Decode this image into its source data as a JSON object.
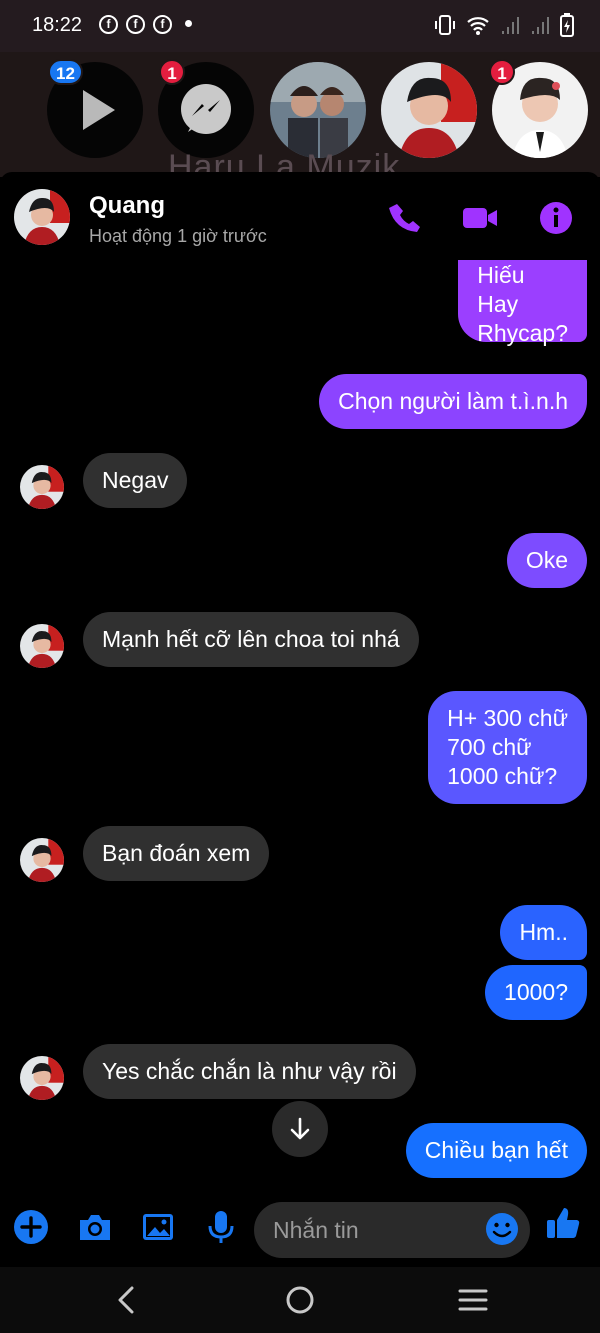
{
  "status_bar": {
    "time": "18:22",
    "notification_icon_glyph": "f",
    "icons": [
      "facebook-notification-icon",
      "facebook-notification-icon",
      "facebook-notification-icon",
      "vibrate-icon",
      "wifi-icon",
      "signal-icon",
      "signal-icon",
      "battery-charging-icon"
    ]
  },
  "stories": {
    "items": [
      {
        "badge": "12",
        "badge_color": "#1877f2",
        "icon": "play-icon"
      },
      {
        "badge": "1",
        "badge_color": "#e41e3f",
        "icon": "messenger-icon"
      },
      {
        "badge": "",
        "icon": "avatar-photo"
      },
      {
        "badge": "",
        "icon": "avatar-photo"
      },
      {
        "badge": "1",
        "badge_color": "#e41e3f",
        "icon": "avatar-photo"
      }
    ],
    "background_text": "Haru La Muzik..."
  },
  "header": {
    "name": "Quang",
    "status": "Hoạt động 1 giờ trước",
    "accent": "#a033ff"
  },
  "messages": [
    {
      "side": "out",
      "text": "Anh xài\nHiếu\nHay\nRhycap?",
      "color": "#9b3fff"
    },
    {
      "side": "out",
      "text": "Chọn người làm t.ì.n.h",
      "color": "#8c44ff"
    },
    {
      "side": "in",
      "text": "Negav"
    },
    {
      "side": "out",
      "text": "Oke",
      "color": "#7d4cff"
    },
    {
      "side": "in",
      "text": "Mạnh hết cỡ lên choa toi nhá"
    },
    {
      "side": "out",
      "text": "H+ 300 chữ\n700 chữ\n1000 chữ?",
      "color": "#5a57ff"
    },
    {
      "side": "in",
      "text": "Bạn đoán xem"
    },
    {
      "side": "out",
      "text": "Hm..",
      "color": "#2a63ff"
    },
    {
      "side": "out",
      "text": "1000?",
      "color": "#1f66ff"
    },
    {
      "side": "in",
      "text": "Yes chắc chắn là như vậy rồi"
    },
    {
      "side": "out",
      "text": "Chiều bạn hết",
      "color": "#1670ff"
    }
  ],
  "composer": {
    "placeholder": "Nhắn tin",
    "accent": "#1877f2"
  }
}
